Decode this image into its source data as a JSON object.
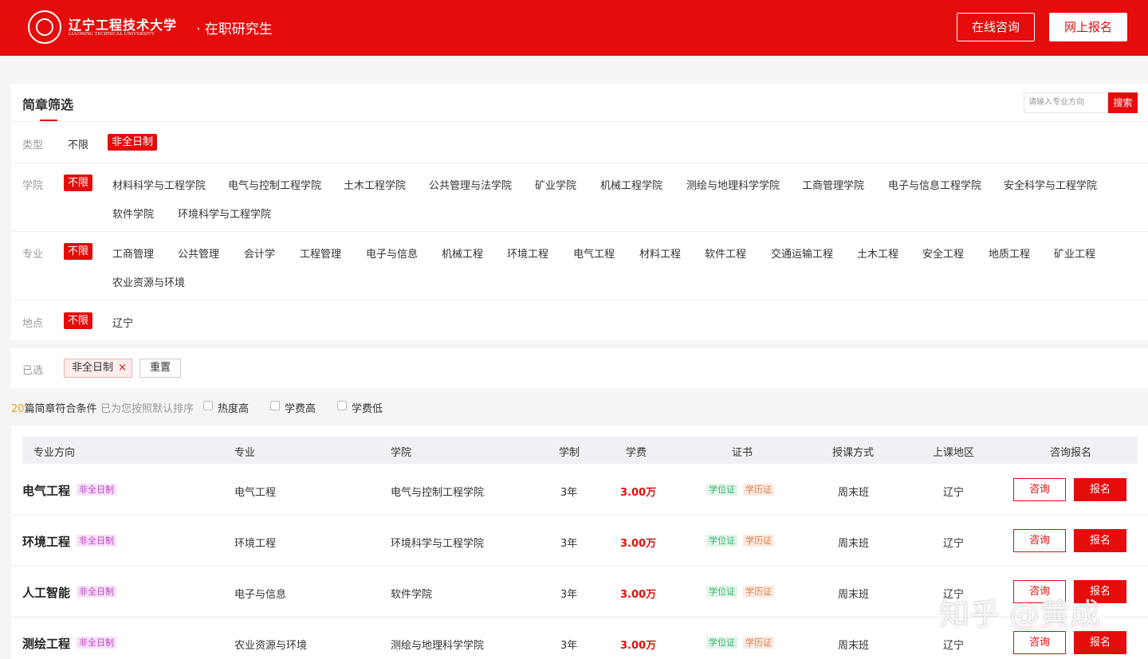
{
  "header": {
    "school_cn": "辽宁工程技术大学",
    "school_en": "LIAONING TECHNICAL UNIVERSITY",
    "subtitle": "· 在职研究生",
    "consult_btn": "在线咨询",
    "apply_btn": "网上报名",
    "brand_color": "#e50c0c"
  },
  "filter": {
    "title": "简章筛选",
    "search_placeholder": "请输入专业方向",
    "search_btn": "搜索",
    "type": {
      "label": "类型",
      "options": [
        "不限",
        "非全日制"
      ],
      "active": "非全日制"
    },
    "college": {
      "label": "学院",
      "active": "不限",
      "options": [
        "材料科学与工程学院",
        "电气与控制工程学院",
        "土木工程学院",
        "公共管理与法学院",
        "矿业学院",
        "机械工程学院",
        "测绘与地理科学学院",
        "工商管理学院",
        "电子与信息工程学院",
        "安全科学与工程学院",
        "软件学院",
        "环境科学与工程学院"
      ]
    },
    "major": {
      "label": "专业",
      "active": "不限",
      "options": [
        "工商管理",
        "公共管理",
        "会计学",
        "工程管理",
        "电子与信息",
        "机械工程",
        "环境工程",
        "电气工程",
        "材料工程",
        "软件工程",
        "交通运输工程",
        "土木工程",
        "安全工程",
        "地质工程",
        "矿业工程",
        "农业资源与环境"
      ]
    },
    "location": {
      "label": "地点",
      "active": "不限",
      "options": [
        "辽宁"
      ]
    }
  },
  "selected": {
    "label": "已选",
    "chip": "非全日制",
    "chip_close": "×",
    "reset": "重置"
  },
  "summary": {
    "count": "20",
    "count_text": "篇简章符合条件",
    "sort_hint": "已为您按照默认排序",
    "sort_options": [
      "热度高",
      "学费高",
      "学费低"
    ]
  },
  "table": {
    "headers": [
      "专业方向",
      "专业",
      "学院",
      "学制",
      "学费",
      "证书",
      "授课方式",
      "上课地区",
      "咨询报名"
    ],
    "rows": [
      {
        "direction": "电气工程",
        "badge": "非全日制",
        "major": "电气工程",
        "college": "电气与控制工程学院",
        "years": "3年",
        "fee": "3.00万",
        "cert1": "学位证",
        "cert2": "学历证",
        "mode": "周末班",
        "region": "辽宁",
        "consult": "咨询",
        "apply": "报名"
      },
      {
        "direction": "环境工程",
        "badge": "非全日制",
        "major": "环境工程",
        "college": "环境科学与工程学院",
        "years": "3年",
        "fee": "3.00万",
        "cert1": "学位证",
        "cert2": "学历证",
        "mode": "周末班",
        "region": "辽宁",
        "consult": "咨询",
        "apply": "报名"
      },
      {
        "direction": "人工智能",
        "badge": "非全日制",
        "major": "电子与信息",
        "college": "软件学院",
        "years": "3年",
        "fee": "3.00万",
        "cert1": "学位证",
        "cert2": "学历证",
        "mode": "周末班",
        "region": "辽宁",
        "consult": "咨询",
        "apply": "报名"
      },
      {
        "direction": "测绘工程",
        "badge": "非全日制",
        "major": "农业资源与环境",
        "college": "测绘与地理科学学院",
        "years": "3年",
        "fee": "3.00万",
        "cert1": "学位证",
        "cert2": "学历证",
        "mode": "周末班",
        "region": "辽宁",
        "consult": "咨询",
        "apply": "报名"
      }
    ]
  },
  "watermark": "知乎 @黄成"
}
